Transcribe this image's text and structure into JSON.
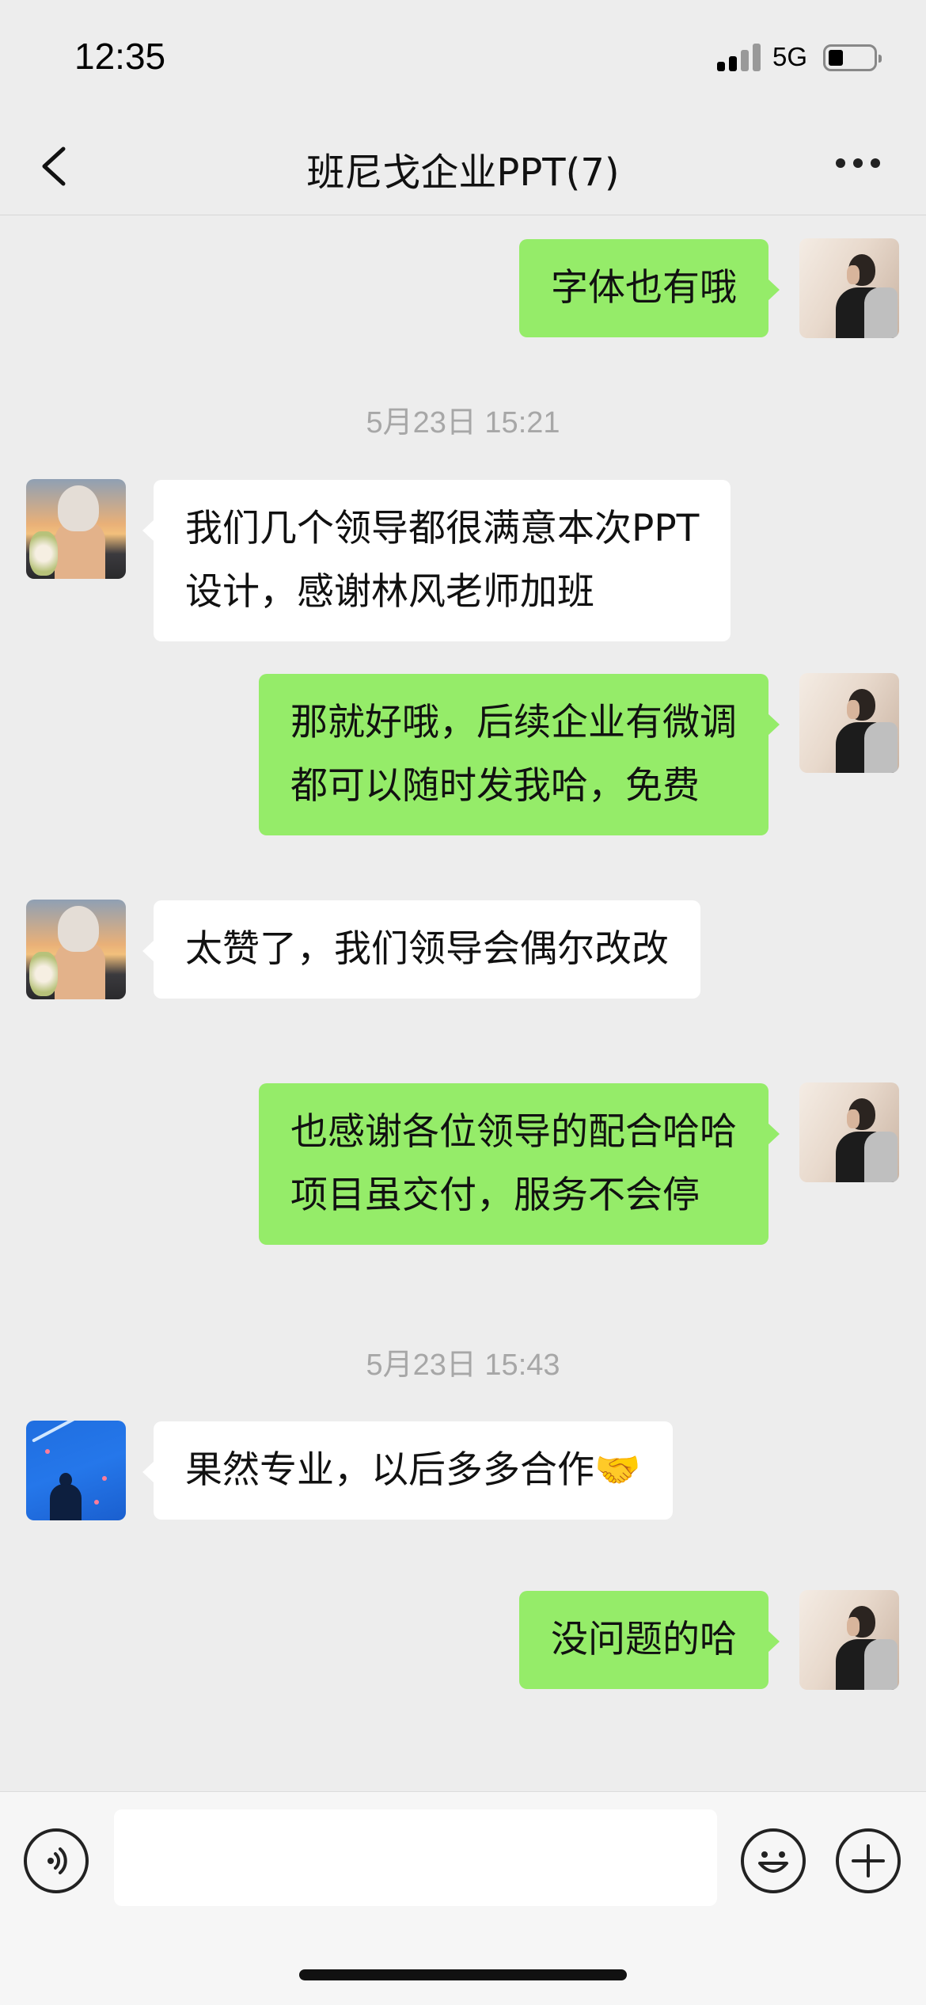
{
  "status_bar": {
    "time": "12:35",
    "network": "5G"
  },
  "nav": {
    "title": "班尼戈企业PPT(7)",
    "back_icon": "chevron-left-icon",
    "more_icon": "more-dots-icon"
  },
  "messages": [
    {
      "sender": "self",
      "text": "字体也有哦"
    },
    {
      "timestamp": "5月23日 15:21"
    },
    {
      "sender": "contact-a",
      "text": "我们几个领导都很满意本次PPT\n设计，感谢林风老师加班"
    },
    {
      "sender": "self",
      "text": "那就好哦，后续企业有微调\n都可以随时发我哈，免费"
    },
    {
      "sender": "contact-a",
      "text": "太赞了，我们领导会偶尔改改"
    },
    {
      "sender": "self",
      "text": "也感谢各位领导的配合哈哈\n项目虽交付，服务不会停"
    },
    {
      "timestamp": "5月23日 15:43"
    },
    {
      "sender": "contact-b",
      "text": "果然专业，以后多多合作🤝"
    },
    {
      "sender": "self",
      "text": "没问题的哈"
    }
  ],
  "input_bar": {
    "voice_icon": "voice-icon",
    "emoji_icon": "emoji-icon",
    "plus_icon": "plus-icon",
    "message_value": ""
  },
  "colors": {
    "background": "#ededed",
    "self_bubble": "#95ec69",
    "other_bubble": "#ffffff",
    "timestamp": "#a7a7a7"
  }
}
